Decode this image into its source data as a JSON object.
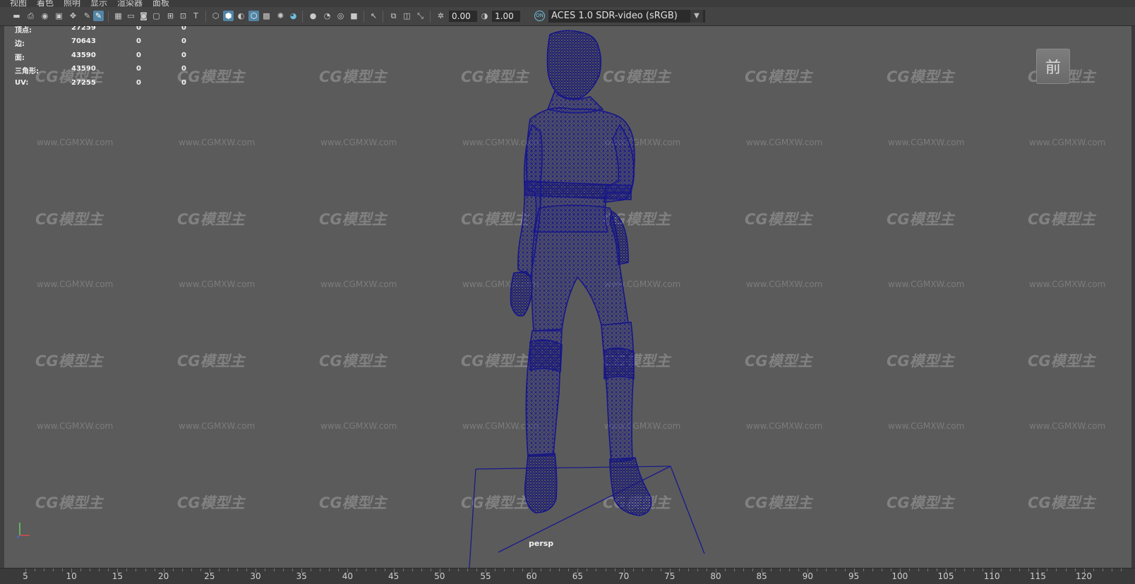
{
  "menu": [
    "视图",
    "着色",
    "照明",
    "显示",
    "渲染器",
    "面板"
  ],
  "toolbar": {
    "icons": [
      {
        "name": "select-camera-icon",
        "glyph": "▬"
      },
      {
        "name": "camera-attributes-icon",
        "glyph": "⎙"
      },
      {
        "name": "bookmark-icon",
        "glyph": "◉"
      },
      {
        "name": "image-plane-icon",
        "glyph": "▣"
      },
      {
        "name": "2d-pan-zoom-icon",
        "glyph": "✥"
      },
      {
        "name": "grease-pencil-icon",
        "glyph": "✎"
      },
      {
        "name": "grid-icon",
        "glyph": "▦"
      },
      {
        "name": "film-gate-icon",
        "glyph": "▭"
      },
      {
        "name": "resolution-gate-icon",
        "glyph": "◙"
      },
      {
        "name": "gate-mask-icon",
        "glyph": "▢"
      },
      {
        "name": "field-chart-icon",
        "glyph": "⊞"
      },
      {
        "name": "safe-action-icon",
        "glyph": "⊡"
      },
      {
        "name": "safe-title-icon",
        "glyph": "T"
      },
      {
        "name": "wireframe-icon",
        "glyph": "⬡"
      },
      {
        "name": "smooth-shade-icon",
        "glyph": "⬢"
      },
      {
        "name": "default-material-icon",
        "glyph": "◐"
      },
      {
        "name": "wireframe-on-shaded-icon",
        "glyph": "⬡"
      },
      {
        "name": "textured-icon",
        "glyph": "▩"
      },
      {
        "name": "use-all-lights-icon",
        "glyph": "✺"
      },
      {
        "name": "shadows-icon",
        "glyph": "◕"
      },
      {
        "name": "screen-space-ao-icon",
        "glyph": "●"
      },
      {
        "name": "motion-blur-icon",
        "glyph": "◔"
      },
      {
        "name": "multisample-aa-icon",
        "glyph": "◎"
      },
      {
        "name": "depth-of-field-icon",
        "glyph": "■"
      },
      {
        "name": "isolate-select-icon",
        "glyph": "↖"
      },
      {
        "name": "xray-icon",
        "glyph": "⧉"
      },
      {
        "name": "xray-joints-icon",
        "glyph": "◫"
      },
      {
        "name": "xray-active-components-icon",
        "glyph": "⤡"
      },
      {
        "name": "exposure-icon",
        "glyph": "✲"
      },
      {
        "name": "gamma-icon",
        "glyph": "◑"
      },
      {
        "name": "color-management-icon",
        "glyph": "ON"
      }
    ],
    "exposure_value": "0.00",
    "gamma_value": "1.00",
    "colorspace": "ACES 1.0 SDR-video (sRGB)"
  },
  "hud": {
    "rows": [
      {
        "label": "顶点:",
        "v1": "27259",
        "v2": "0",
        "v3": "0"
      },
      {
        "label": "边:",
        "v1": "70643",
        "v2": "0",
        "v3": "0"
      },
      {
        "label": "面:",
        "v1": "43590",
        "v2": "0",
        "v3": "0"
      },
      {
        "label": "三角形:",
        "v1": "43590",
        "v2": "0",
        "v3": "0"
      },
      {
        "label": "UV:",
        "v1": "27255",
        "v2": "0",
        "v3": "0"
      }
    ]
  },
  "viewcube_label": "前",
  "camera_name": "persp",
  "watermark": {
    "logo": "CG模型主",
    "url": "www.CGMXW.com"
  },
  "colors": {
    "wireframe": "#1a1a8c",
    "viewport_bg": "#5b5b5b",
    "accent": "#5285a6"
  },
  "timeline": {
    "ticks": [
      "5",
      "10",
      "15",
      "20",
      "25",
      "30",
      "35",
      "40",
      "45",
      "50",
      "55",
      "60",
      "65",
      "70",
      "75",
      "80",
      "85",
      "90",
      "95",
      "100",
      "105",
      "110",
      "115",
      "120"
    ]
  }
}
